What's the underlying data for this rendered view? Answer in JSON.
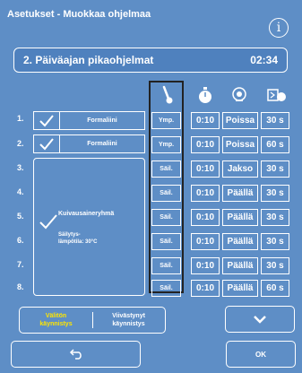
{
  "header": {
    "title": "Asetukset - Muokkaa ohjelmaa",
    "info_icon": "info-icon"
  },
  "program": {
    "name": "2. Päiväajan pikaohjelmat",
    "time": "02:34"
  },
  "columns": {
    "icons": [
      "thermometer-icon",
      "timer-icon",
      "drying-icon",
      "heater-timer-icon"
    ]
  },
  "rows": [
    {
      "num": "1.",
      "temp": "Ymp.",
      "time": "0:10",
      "mode": "Poissa",
      "sec": "30 s"
    },
    {
      "num": "2.",
      "temp": "Ymp.",
      "time": "0:10",
      "mode": "Poissa",
      "sec": "60 s"
    },
    {
      "num": "3.",
      "temp": "Säil.",
      "time": "0:10",
      "mode": "Jakso",
      "sec": "30 s"
    },
    {
      "num": "4.",
      "temp": "Säil.",
      "time": "0:10",
      "mode": "Päällä",
      "sec": "30 s"
    },
    {
      "num": "5.",
      "temp": "Säil.",
      "time": "0:10",
      "mode": "Päällä",
      "sec": "30 s"
    },
    {
      "num": "6.",
      "temp": "Säil.",
      "time": "0:10",
      "mode": "Päällä",
      "sec": "30 s"
    },
    {
      "num": "7.",
      "temp": "Säil.",
      "time": "0:10",
      "mode": "Päällä",
      "sec": "30 s"
    },
    {
      "num": "8.",
      "temp": "Säil.",
      "time": "0:10",
      "mode": "Päällä",
      "sec": "60 s"
    }
  ],
  "agents": {
    "row1": "Formaliini",
    "row2": "Formaliini"
  },
  "group": {
    "name": "Kuivausaineryhmä",
    "storage_line1": "Säilytys-",
    "storage_line2": "lämpötila: 30°C"
  },
  "start": {
    "immediate_line1": "Välitön",
    "immediate_line2": "käynnistys",
    "delayed_line1": "Viivästynyt",
    "delayed_line2": "käynnistys"
  },
  "buttons": {
    "ok": "OK"
  },
  "colors": {
    "background": "#5e8ec6",
    "accent_yellow": "#ffe600"
  }
}
